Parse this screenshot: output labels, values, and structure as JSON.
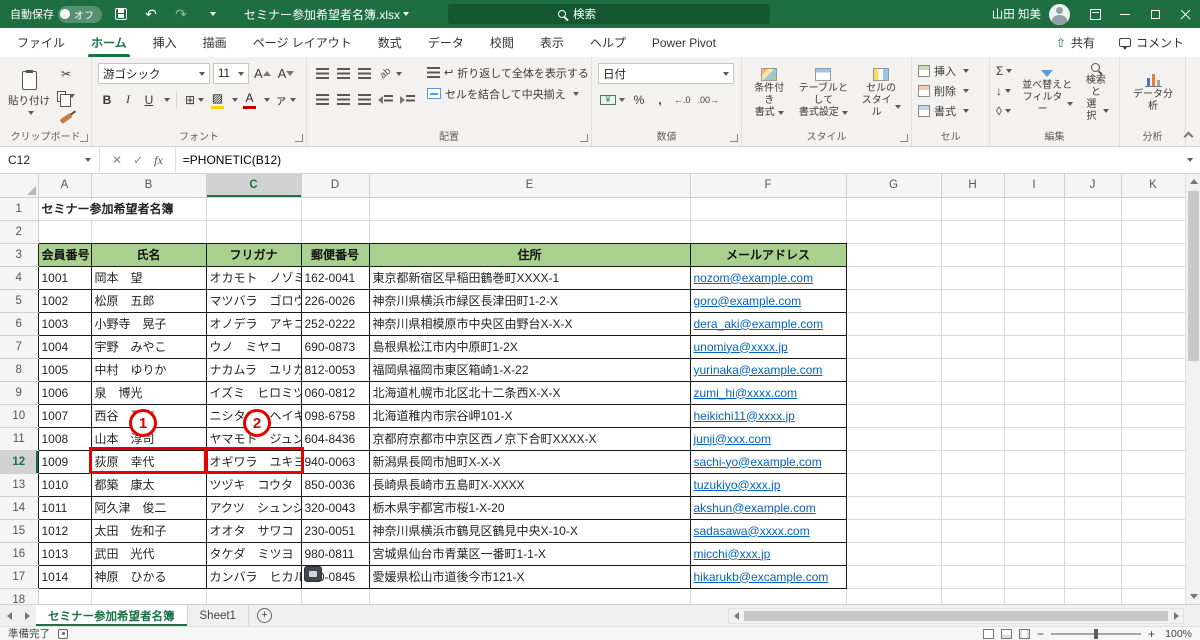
{
  "title_bar": {
    "autosave_label": "自動保存",
    "autosave_state": "オフ",
    "file_name": "セミナー参加希望者名簿.xlsx",
    "search_placeholder": "検索",
    "user_name": "山田 知美"
  },
  "ribbon_tabs": [
    "ファイル",
    "ホーム",
    "挿入",
    "描画",
    "ページ レイアウト",
    "数式",
    "データ",
    "校閲",
    "表示",
    "ヘルプ",
    "Power Pivot"
  ],
  "top_actions": {
    "share": "共有",
    "comments": "コメント"
  },
  "ribbon": {
    "groups": [
      "クリップボード",
      "フォント",
      "配置",
      "数値",
      "スタイル",
      "セル",
      "編集",
      "分析"
    ],
    "paste_label": "貼り付け",
    "font_name": "游ゴシック",
    "font_size": "11",
    "wrap_text_label": "折り返して全体を表示する",
    "merge_center_label": "セルを結合して中央揃え",
    "number_format": "日付",
    "conditional_format": [
      "条件付き",
      "書式"
    ],
    "format_as_table": [
      "テーブルとして",
      "書式設定"
    ],
    "cell_styles": [
      "セルの",
      "スタイル"
    ],
    "cells_buttons": [
      "挿入",
      "削除",
      "書式"
    ],
    "sort_filter": [
      "並べ替えと",
      "フィルター"
    ],
    "find_select": [
      "検索と",
      "選択"
    ],
    "data_analysis": "データ分析"
  },
  "icons": {
    "undo": "↶",
    "redo": "↷",
    "cut": "✂",
    "bold": "B",
    "italic": "I",
    "underline": "U",
    "borders": "⊞",
    "fill_color": "▨",
    "font_color": "A",
    "phonetic": "ァ",
    "grow_font": "A",
    "shrink_font": "A",
    "return_arrow": "↩",
    "currency": "¥",
    "percent": "%",
    "comma": ",",
    "increase_decimal": "←.0",
    "decrease_decimal": ".00→",
    "sum": "Σ",
    "fill_down": "↓",
    "clear": "◊",
    "share": "⇧",
    "fx": "fx",
    "cancel": "✕",
    "enter": "✓",
    "orientation": "ab"
  },
  "formula_bar": {
    "name_box": "C12",
    "formula": "=PHONETIC(B12)"
  },
  "grid": {
    "column_letters": [
      "A",
      "B",
      "C",
      "D",
      "E",
      "F",
      "G",
      "H",
      "I",
      "J",
      "K"
    ],
    "row_numbers": [
      "1",
      "2",
      "3",
      "4",
      "5",
      "6",
      "7",
      "8",
      "9",
      "10",
      "11",
      "12",
      "13",
      "14",
      "15",
      "16",
      "17",
      "18"
    ],
    "selected_cell": "C12",
    "sheet_title": "セミナー参加希望者名簿",
    "table_headers": [
      "会員番号",
      "氏名",
      "フリガナ",
      "郵便番号",
      "住所",
      "メールアドレス"
    ],
    "records": [
      {
        "id": "1001",
        "name": "岡本　望",
        "kana": "オカモト　ノゾミ",
        "zip": "162-0041",
        "address": "東京都新宿区早稲田鶴巻町XXXX-1",
        "email": "nozom@example.com"
      },
      {
        "id": "1002",
        "name": "松原　五郎",
        "kana": "マツバラ　ゴロウ",
        "zip": "226-0026",
        "address": "神奈川県横浜市緑区長津田町1-2-X",
        "email": "goro@example.com"
      },
      {
        "id": "1003",
        "name": "小野寺　晃子",
        "kana": "オノデラ　アキコ",
        "zip": "252-0222",
        "address": "神奈川県相模原市中央区由野台X-X-X",
        "email": "dera_aki@example.com"
      },
      {
        "id": "1004",
        "name": "宇野　みやこ",
        "kana": "ウノ　ミヤコ",
        "zip": "690-0873",
        "address": "島根県松江市内中原町1-2X",
        "email": "unomiya@xxxx.jp"
      },
      {
        "id": "1005",
        "name": "中村　ゆりか",
        "kana": "ナカムラ　ユリカ",
        "zip": "812-0053",
        "address": "福岡県福岡市東区箱崎1-X-22",
        "email": "yurinaka@example.com"
      },
      {
        "id": "1006",
        "name": "泉　博光",
        "kana": "イズミ　ヒロミツ",
        "zip": "060-0812",
        "address": "北海道札幌市北区北十二条西X-X-X",
        "email": "zumi_hi@xxxx.com"
      },
      {
        "id": "1007",
        "name": "西谷　平吉",
        "kana": "ニシタニ　ヘイキチ",
        "zip": "098-6758",
        "address": "北海道稚内市宗谷岬101-X",
        "email": "heikichi11@xxxx.jp"
      },
      {
        "id": "1008",
        "name": "山本　淳司",
        "kana": "ヤマモト　ジュンジ",
        "zip": "604-8436",
        "address": "京都府京都市中京区西ノ京下合町XXXX-X",
        "email": "junji@xxx.com"
      },
      {
        "id": "1009",
        "name": "荻原　幸代",
        "kana": "オギワラ　ユキヨ",
        "zip": "940-0063",
        "address": "新潟県長岡市旭町X-X-X",
        "email": "sachi-yo@example.com"
      },
      {
        "id": "1010",
        "name": "都築　康太",
        "kana": "ツヅキ　コウタ",
        "zip": "850-0036",
        "address": "長崎県長崎市五島町X-XXXX",
        "email": "tuzukiyo@xxx.jp"
      },
      {
        "id": "1011",
        "name": "阿久津　俊二",
        "kana": "アクツ　シュンジ",
        "zip": "320-0043",
        "address": "栃木県宇都宮市桜1-X-20",
        "email": "akshun@example.com"
      },
      {
        "id": "1012",
        "name": "太田　佐和子",
        "kana": "オオタ　サワコ",
        "zip": "230-0051",
        "address": "神奈川県横浜市鶴見区鶴見中央X-10-X",
        "email": "sadasawa@xxxx.com"
      },
      {
        "id": "1013",
        "name": "武田　光代",
        "kana": "タケダ　ミツヨ",
        "zip": "980-0811",
        "address": "宮城県仙台市青葉区一番町1-1-X",
        "email": "micchi@xxx.jp"
      },
      {
        "id": "1014",
        "name": "神原　ひかる",
        "kana": "カンバラ　ヒカル",
        "zip": "790-0845",
        "address": "愛媛県松山市道後今市121-X",
        "email": "hikarukb@excample.com"
      }
    ],
    "annotations": {
      "marker_1": "1",
      "marker_2": "2"
    }
  },
  "sheet_tabs": {
    "active": "セミナー参加希望者名簿",
    "other": "Sheet1"
  },
  "status_bar": {
    "ready": "準備完了",
    "zoom": "100%"
  },
  "colors": {
    "title_green": "#1e6e42",
    "accent_green": "#1e7145",
    "table_header_green": "#a9d08e",
    "link_blue": "#0563c1",
    "annotation_red": "#e60000"
  }
}
